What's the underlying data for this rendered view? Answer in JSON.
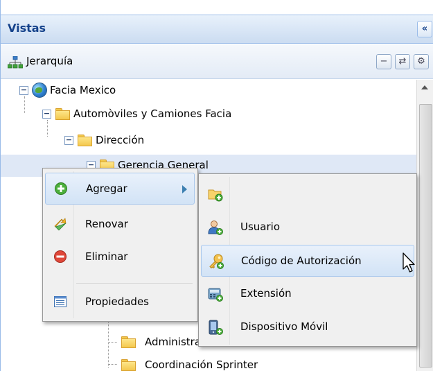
{
  "panel": {
    "title": "Vistas",
    "collapse_glyph": "«"
  },
  "toolbar": {
    "title": "Jerarquía",
    "icon": "hierarchy-icon",
    "buttons": [
      {
        "name": "collapse-all-button",
        "glyph": "−"
      },
      {
        "name": "refresh-button",
        "glyph": "⇄"
      },
      {
        "name": "settings-button",
        "glyph": "⚙"
      }
    ]
  },
  "tree": {
    "nodes": [
      {
        "label": "Facia Mexico",
        "icon": "globe-icon",
        "expanded": true
      },
      {
        "label": "Automòviles y Camiones Facia",
        "icon": "folder-icon",
        "expanded": true
      },
      {
        "label": "Dirección",
        "icon": "folder-icon",
        "expanded": true
      },
      {
        "label": "Gerencia General",
        "icon": "folder-icon",
        "expanded": true,
        "selected": true
      },
      {
        "label": "Administración",
        "icon": "folder-icon"
      },
      {
        "label": "Coordinación Sprinter",
        "icon": "folder-icon"
      }
    ]
  },
  "context_menu": {
    "items": [
      {
        "label": "Agregar",
        "icon": "add-icon",
        "has_submenu": true,
        "active": true
      },
      {
        "label": "Renovar",
        "icon": "renew-icon"
      },
      {
        "label": "Eliminar",
        "icon": "delete-icon"
      },
      {
        "label": "Propiedades",
        "icon": "properties-icon"
      }
    ]
  },
  "submenu": {
    "items": [
      {
        "label": "",
        "icon": "add-folder-icon"
      },
      {
        "label": "Usuario",
        "icon": "user-icon"
      },
      {
        "label": "Código de Autorización",
        "icon": "key-icon",
        "active": true
      },
      {
        "label": "Extensión",
        "icon": "phone-extension-icon"
      },
      {
        "label": "Dispositivo Móvil",
        "icon": "mobile-device-icon"
      }
    ]
  },
  "colors": {
    "header_text": "#15428b",
    "selection": "#dfe8f6",
    "menu_bg": "#f0f0f0",
    "menu_highlight": "#d2e3f6"
  }
}
